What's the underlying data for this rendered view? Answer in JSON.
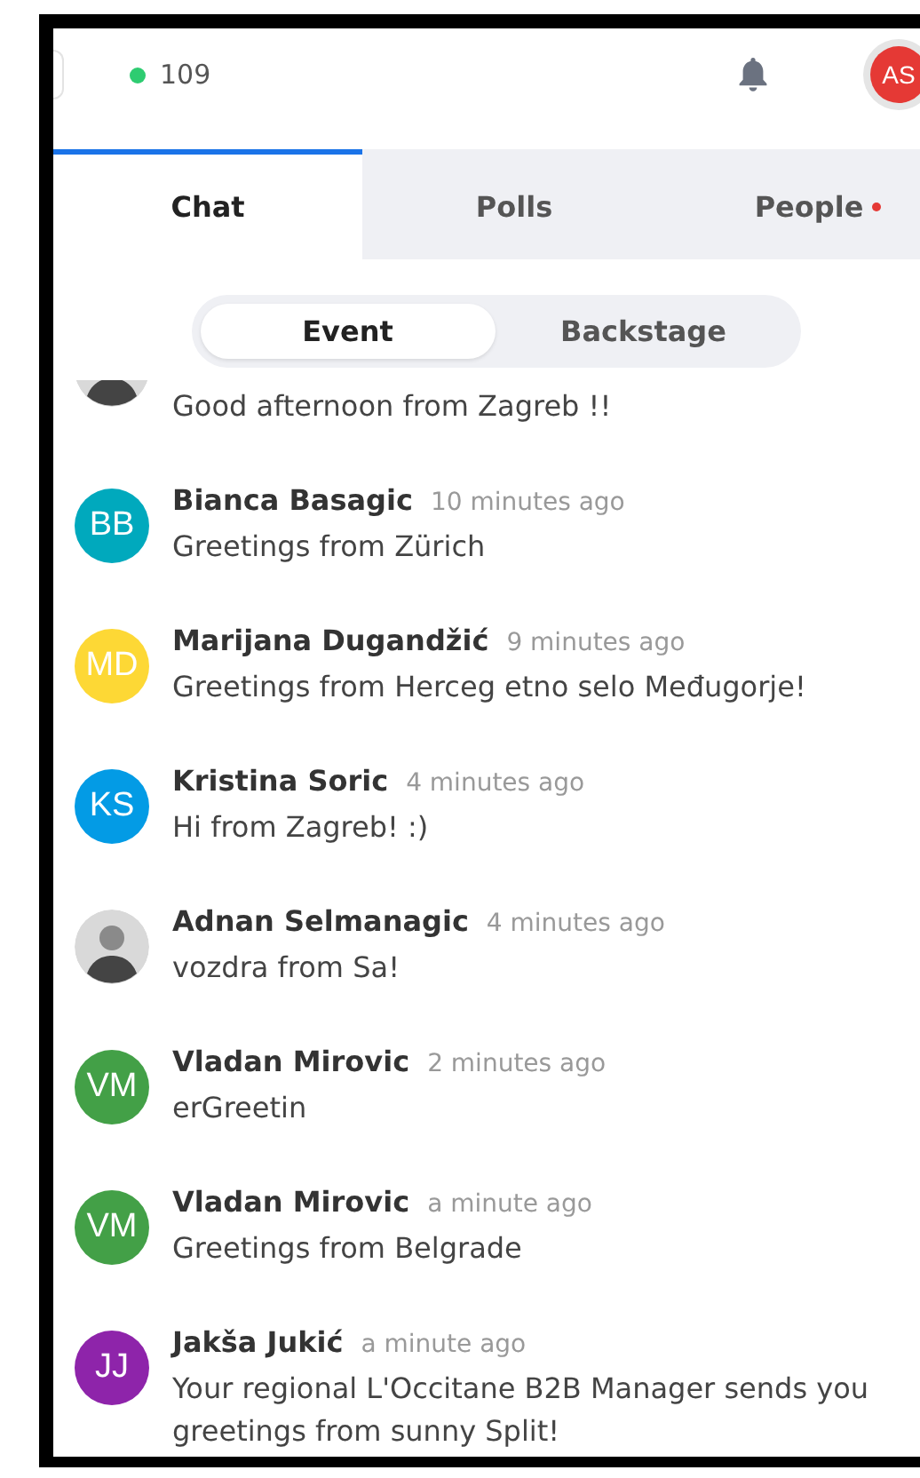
{
  "top_bar": {
    "online_count": "109",
    "user_avatar": "AS"
  },
  "tabs": [
    {
      "label": "Chat",
      "selected": true,
      "badge": false
    },
    {
      "label": "Polls",
      "selected": false,
      "badge": false
    },
    {
      "label": "People",
      "selected": false,
      "badge": true
    }
  ],
  "channel_switch": [
    {
      "label": "Event",
      "selected": true
    },
    {
      "label": "Backstage",
      "selected": false
    }
  ],
  "messages": [
    {
      "avatar": {
        "kind": "photo"
      },
      "text": "Good afternoon from Zagreb !!"
    },
    {
      "avatar": {
        "kind": "initials",
        "initials": "BB",
        "color": "#00a9bd"
      },
      "name": "Bianca Basagic",
      "time": "10 minutes ago",
      "text": "Greetings from Zürich"
    },
    {
      "avatar": {
        "kind": "initials",
        "initials": "MD",
        "color": "#fdd835"
      },
      "name": "Marijana Dugandžić",
      "time": "9 minutes ago",
      "text": "Greetings from Herceg etno selo Međugorje!"
    },
    {
      "avatar": {
        "kind": "initials",
        "initials": "KS",
        "color": "#039be5"
      },
      "name": "Kristina Soric",
      "time": "4 minutes ago",
      "text": "Hi from Zagreb! :)"
    },
    {
      "avatar": {
        "kind": "photo"
      },
      "name": "Adnan Selmanagic",
      "time": "4 minutes ago",
      "text": "vozdra from Sa!"
    },
    {
      "avatar": {
        "kind": "initials",
        "initials": "VM",
        "color": "#43a047"
      },
      "name": "Vladan Mirovic",
      "time": "2 minutes ago",
      "text": "erGreetin"
    },
    {
      "avatar": {
        "kind": "initials",
        "initials": "VM",
        "color": "#43a047"
      },
      "name": "Vladan Mirovic",
      "time": "a minute ago",
      "text": "Greetings from Belgrade"
    },
    {
      "avatar": {
        "kind": "initials",
        "initials": "JJ",
        "color": "#8e24aa"
      },
      "name": "Jakša Jukić",
      "time": "a minute ago",
      "text": "Your regional L'Occitane B2B Manager sends you greetings from sunny Split!"
    }
  ]
}
